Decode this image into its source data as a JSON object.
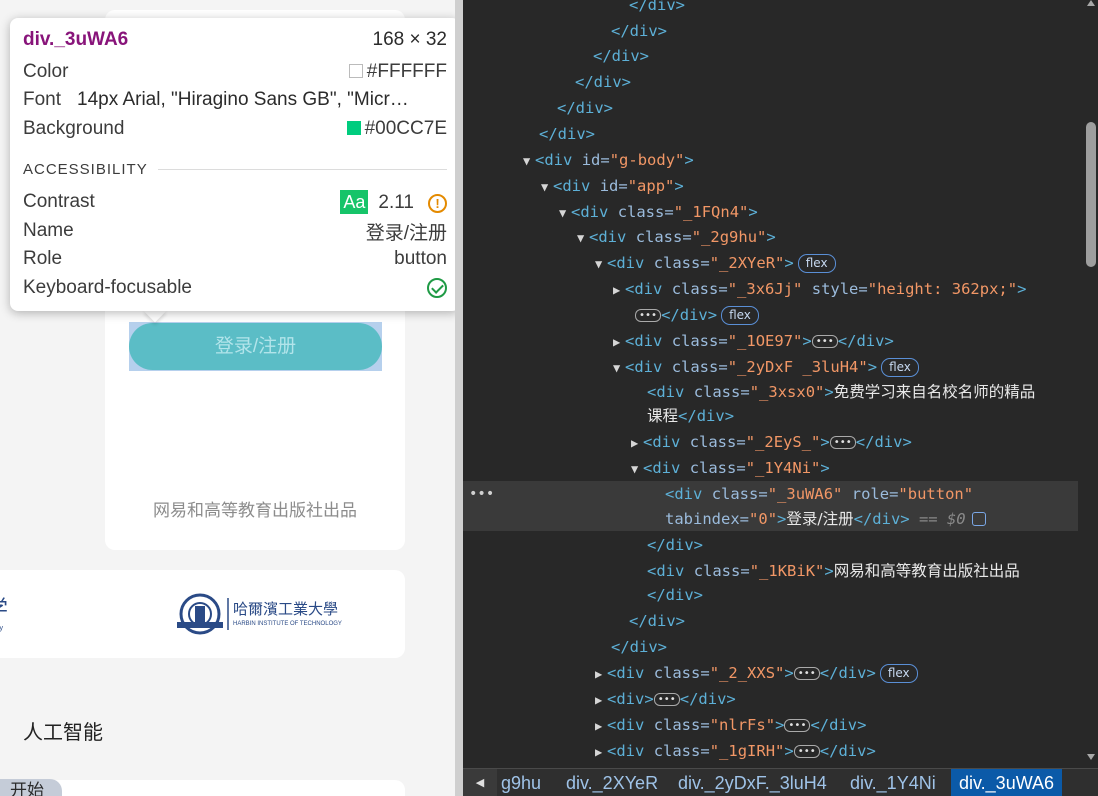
{
  "tooltip": {
    "selector": "div._3uWA6",
    "dimensions": "168 × 32",
    "color_label": "Color",
    "color_value": "#FFFFFF",
    "font_label": "Font",
    "font_value": "14px Arial, \"Hiragino Sans GB\", \"Micr…",
    "background_label": "Background",
    "background_value": "#00CC7E",
    "section_title": "ACCESSIBILITY",
    "contrast_label": "Contrast",
    "contrast_badge": "Aa",
    "contrast_value": "2.11",
    "name_label": "Name",
    "name_value": "登录/注册",
    "role_label": "Role",
    "role_value": "button",
    "keyboard_label": "Keyboard-focusable"
  },
  "page": {
    "login_button": "登录/注册",
    "publisher": "网易和高等教育出版社出品",
    "hit_logo_name": "哈爾濱工業大學",
    "hit_logo_sub": "HARBIN INSTITUTE OF TECHNOLOGY",
    "left_logo_char": "学",
    "left_logo_sub": "ity",
    "section_ai": "人工智能",
    "start_tag": "开始"
  },
  "dom": {
    "l0": "</div>",
    "l1": "</div>",
    "l2": "</div>",
    "l3": "</div>",
    "l4": "</div>",
    "l5": "</div>",
    "l6_tag": "div",
    "l6_attr": "id",
    "l6_val": "g-body",
    "l7_tag": "div",
    "l7_attr": "id",
    "l7_val": "app",
    "l8_tag": "div",
    "l8_attr": "class",
    "l8_val": "_1FQn4",
    "l9_tag": "div",
    "l9_attr": "class",
    "l9_val": "_2g9hu",
    "l10_tag": "div",
    "l10_attr": "class",
    "l10_val": "_2XYeR",
    "l11_tag": "div",
    "l11_attr": "class",
    "l11_val": "_3x6Jj",
    "l11_attr2": "style",
    "l11_val2": "height: 362px;",
    "l13_tag": "div",
    "l13_attr": "class",
    "l13_val": "_1OE97",
    "l14_tag": "div",
    "l14_attr": "class",
    "l14_val": "_2yDxF _3luH4",
    "l15_tag": "div",
    "l15_attr": "class",
    "l15_val": "_3xsx0",
    "l15_text": "免费学习来自名校名师的精品",
    "l16_text": "课程",
    "l17_tag": "div",
    "l17_attr": "class",
    "l17_val": "_2EyS_",
    "l18_tag": "div",
    "l18_attr": "class",
    "l18_val": "_1Y4Ni",
    "l19_tag": "div",
    "l19_attr": "class",
    "l19_val": "_3uWA6",
    "l19_attr2": "role",
    "l19_val2": "button",
    "l20_attr": "tabindex",
    "l20_val": "0",
    "l20_text": "登录/注册",
    "l20_dollar": "== $0",
    "l22_tag": "div",
    "l22_attr": "class",
    "l22_val": "_1KBiK",
    "l22_text": "网易和高等教育出版社出品",
    "l26_tag": "div",
    "l26_attr": "class",
    "l26_val": "_2_XXS",
    "l27_tag": "div",
    "l28_tag": "div",
    "l28_attr": "class",
    "l28_val": "nlrFs",
    "l29_tag": "div",
    "l29_attr": "class",
    "l29_val": "_1gIRH",
    "flex": "flex",
    "ellipsis": "•••"
  },
  "breadcrumbs": [
    "g9hu",
    "div._2XYeR",
    "div._2yDxF._3luH4",
    "div._1Y4Ni",
    "div._3uWA6"
  ],
  "colors": {
    "tooltip_color_swatch": "#FFFFFF",
    "tooltip_bg_swatch": "#00CC7E",
    "selected_crumb": "#0b5aa8"
  }
}
